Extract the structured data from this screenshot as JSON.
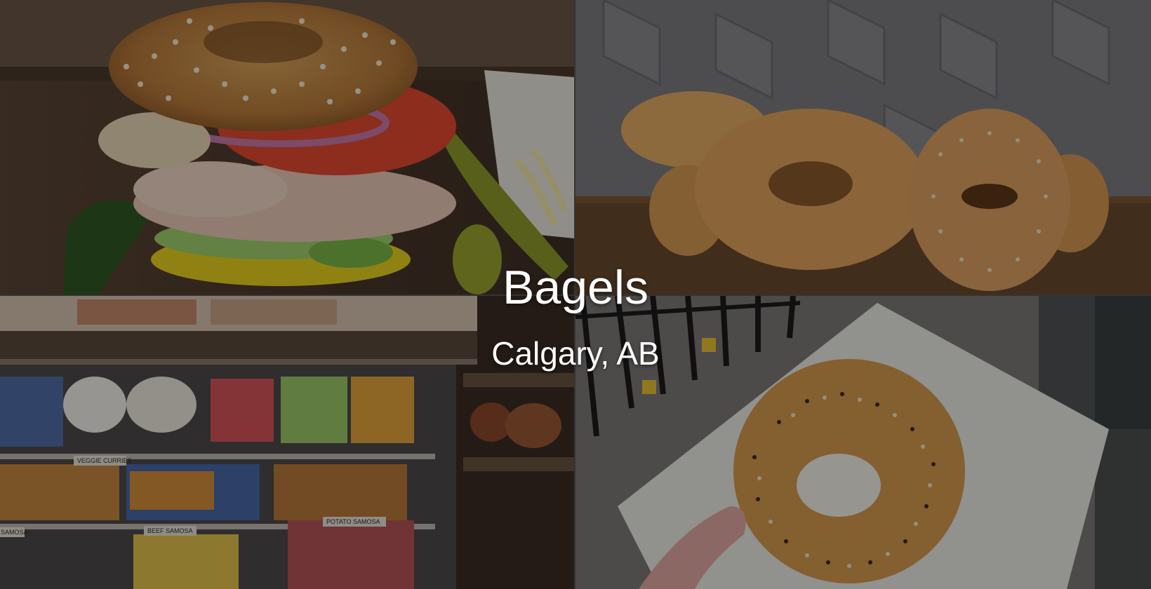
{
  "title": "Bagels",
  "location": "Calgary, AB",
  "photos": {
    "top_left": "bagel-sandwich-photo",
    "top_right": "bagels-on-shelf-photo",
    "bottom_left": "bakery-display-case-photo",
    "bottom_right": "hand-held-bagel-photo"
  },
  "display_labels": [
    "VEGGIE CURRIES",
    "BEEF SAMOSA",
    "POTATO SAMOSA",
    "SAMOSA"
  ],
  "colors": {
    "text": "#ffffff",
    "overlay": "rgba(0,0,0,0.38)"
  }
}
